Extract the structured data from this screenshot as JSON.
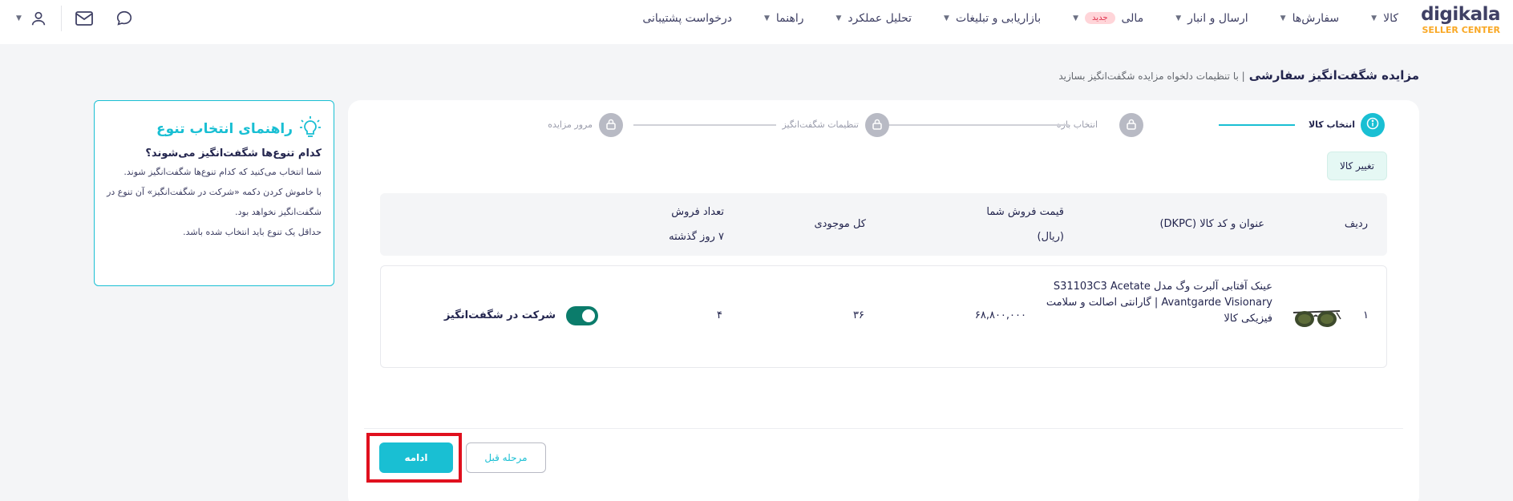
{
  "brand": {
    "logo": "digikala",
    "sub": "SELLER CENTER",
    "accent": "#19bfd3",
    "toggle_color": "#0b7c6b",
    "logo_sub_color": "#f9a825"
  },
  "nav": [
    {
      "label": "کالا"
    },
    {
      "label": "سفارش‌ها"
    },
    {
      "label": "ارسال و انبار"
    },
    {
      "label": "مالی",
      "badge": "جدید"
    },
    {
      "label": "بازاریابی و تبلیغات"
    },
    {
      "label": "تحلیل عملکرد"
    },
    {
      "label": "راهنما"
    },
    {
      "label": "درخواست پشتیبانی"
    }
  ],
  "header_icons": [
    "chat-icon",
    "mail-icon",
    "user-icon",
    "caret-down-icon"
  ],
  "page": {
    "title": "مزایده شگفت‌انگیز سفارشی",
    "subtitle": "| با تنظیمات دلخواه مزایده شگفت‌انگیز بسازید"
  },
  "guide": {
    "title": "راهنمای انتخاب تنوع",
    "question": "کدام تنوع‌ها شگفت‌انگیز می‌شوند؟",
    "p1": "شما انتخاب می‌کنید که کدام تنوع‌ها شگفت‌انگیز شوند.",
    "p2": "با خاموش کردن دکمه «شرکت در شگفت‌انگیز» آن تنوع در شگفت‌انگیز نخواهد بود.",
    "p3": "حداقل یک تنوع باید انتخاب شده باشد."
  },
  "steps": [
    {
      "label": "انتخاب کالا",
      "active": true
    },
    {
      "label": "انتخاب بازه",
      "active": false
    },
    {
      "label": "تنظیمات شگفت‌انگیز",
      "active": false
    },
    {
      "label": "مرور مزایده",
      "active": false
    }
  ],
  "change_button": "تغییر کالا",
  "table": {
    "headers": {
      "row": "ردیف",
      "title": "عنوان و کد کالا (DKPC)",
      "price_1": "قیمت فروش شما",
      "price_2": "(ریال)",
      "stock": "کل موجودی",
      "sales_1": "تعداد فروش",
      "sales_2": "۷ روز گذشته"
    },
    "rows": [
      {
        "index": "۱",
        "title_1": "عینک آفتابی آلبرت وگ مدل S31103C3 Acetate",
        "title_2": "Avantgarde Visionary | گارانتی اصالت و سلامت",
        "title_3": "فیزیکی کالا",
        "price": "۶۸,۸۰۰,۰۰۰",
        "stock": "۳۶",
        "sales": "۴",
        "participate_label": "شرکت در شگفت‌انگیز",
        "participate": true
      }
    ]
  },
  "buttons": {
    "continue": "ادامه",
    "previous": "مرحله قبل"
  }
}
